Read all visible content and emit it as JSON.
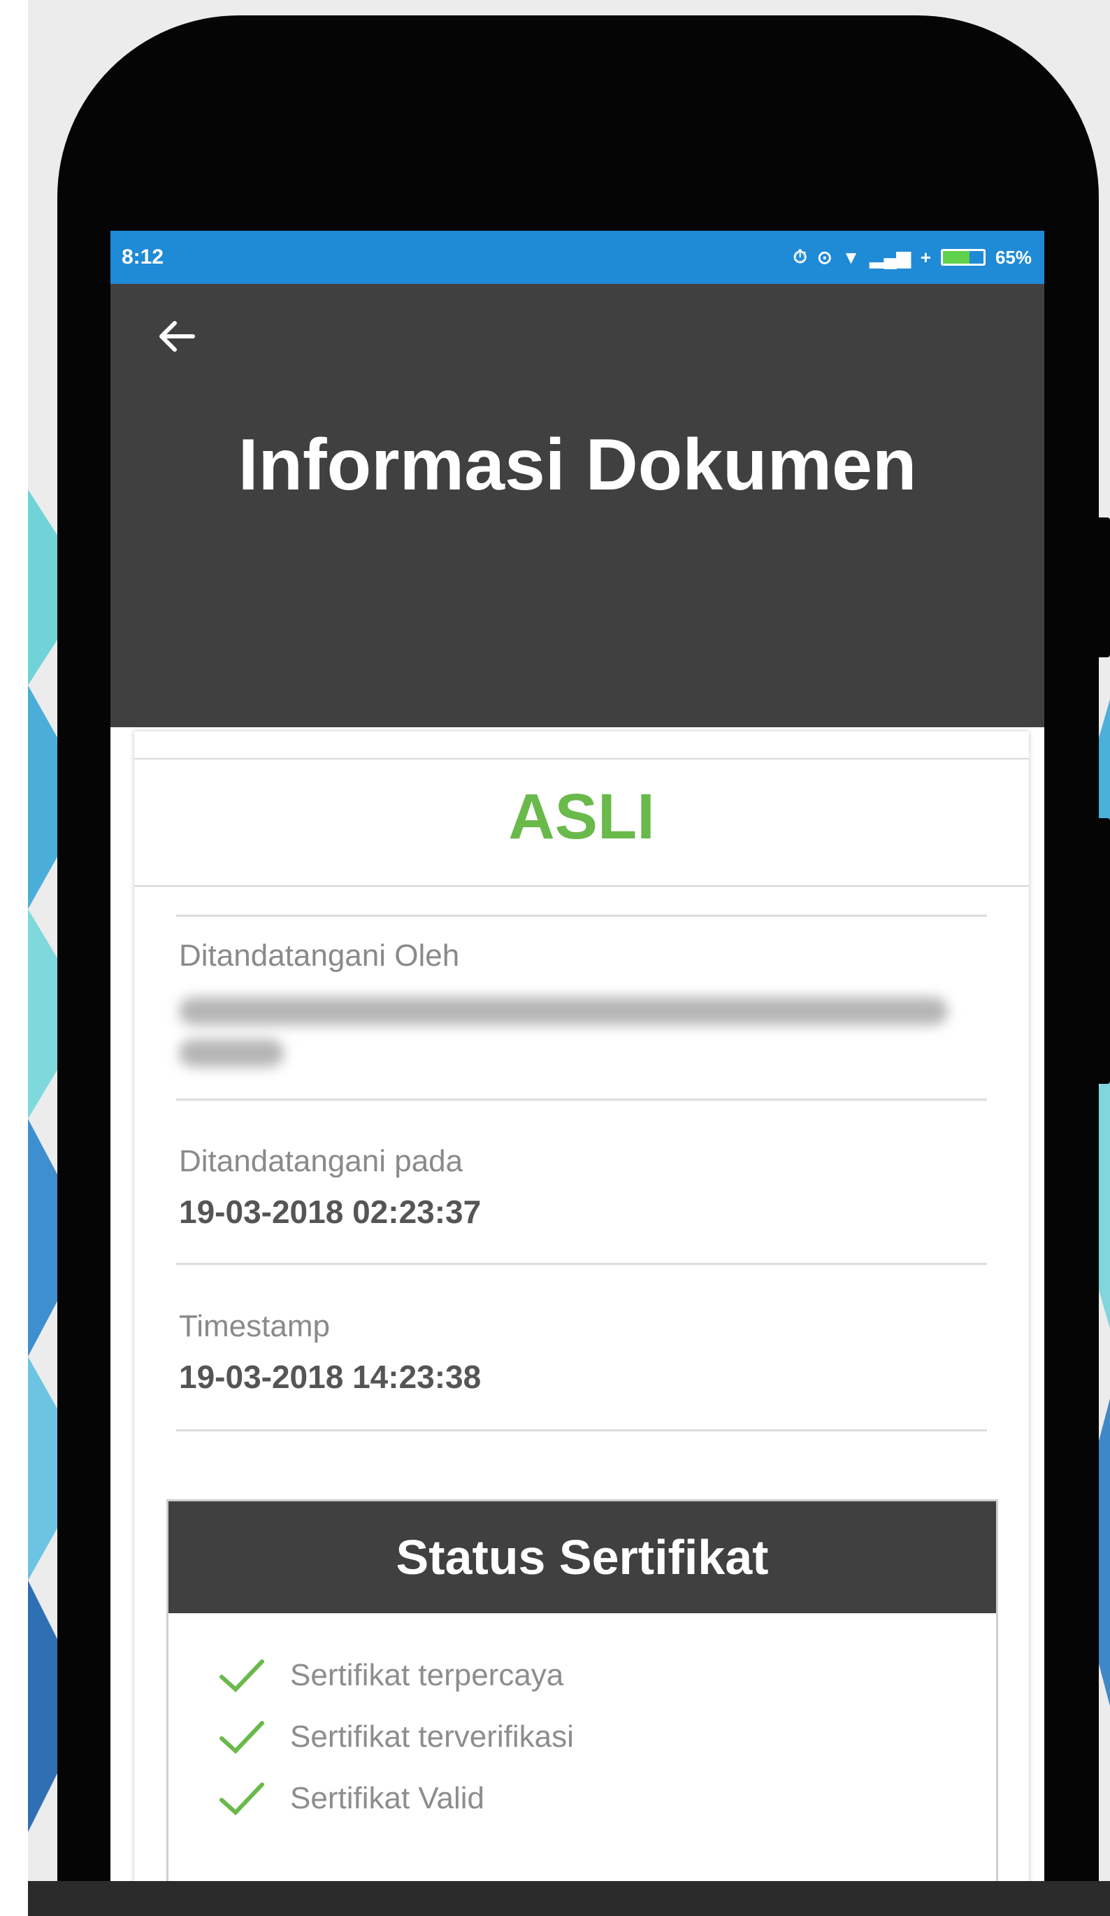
{
  "status_bar": {
    "time": "8:12",
    "battery_percent": "65%",
    "battery_level": 0.65,
    "background_color": "#1f8ad6"
  },
  "header": {
    "back_icon": "arrow-left-icon",
    "title": "Informasi Dokumen",
    "background_color": "#404040"
  },
  "document": {
    "verdict": "ASLI",
    "verdict_color": "#6ab94b",
    "fields": [
      {
        "label": "Ditandatangani Oleh",
        "value_redacted": true
      },
      {
        "label": "Ditandatangani pada",
        "value": "19-03-2018 02:23:37"
      },
      {
        "label": "Timestamp",
        "value": "19-03-2018 14:23:38"
      }
    ]
  },
  "certificate_status": {
    "title": "Status Sertifikat",
    "check_color": "#6ab94b",
    "items": [
      {
        "label": "Sertifikat terpercaya",
        "icon": "check-icon"
      },
      {
        "label": "Sertifikat terverifikasi",
        "icon": "check-icon"
      },
      {
        "label": "Sertifikat Valid",
        "icon": "check-icon"
      }
    ]
  }
}
